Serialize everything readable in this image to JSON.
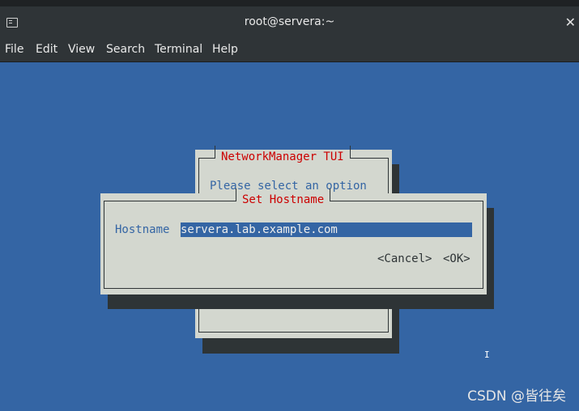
{
  "window": {
    "title": "root@servera:~",
    "close_glyph": "✕"
  },
  "menu": [
    "File",
    "Edit",
    "View",
    "Search",
    "Terminal",
    "Help"
  ],
  "tui": {
    "main_title": "NetworkManager TUI",
    "main_prompt": "Please select an option",
    "dialog_title": "Set Hostname",
    "hostname_label": "Hostname",
    "hostname_value": "servera.lab.example.com",
    "cancel_label": "<Cancel>",
    "ok_label": "<OK>"
  },
  "colors": {
    "background": "#3465a4",
    "dialog": "#d3d7cf",
    "title_red": "#cc0000",
    "shadow": "#2e3436"
  },
  "cursor_glyph": "I",
  "watermark": "CSDN @皆往矣"
}
